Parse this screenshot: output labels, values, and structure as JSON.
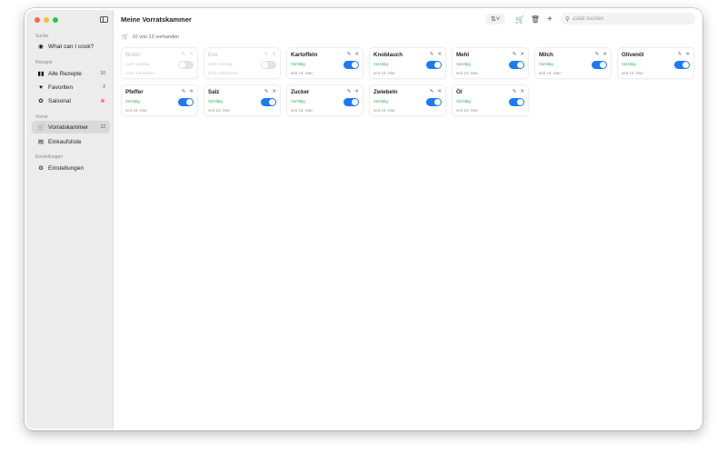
{
  "window": {
    "title": "Meine Vorratskammer"
  },
  "sidebar": {
    "sections": [
      {
        "header": "Suche"
      },
      {
        "header": "Rezepte"
      },
      {
        "header": "Vorrat"
      },
      {
        "header": "Einstellungen"
      }
    ],
    "items": [
      {
        "label": "What can I cook?",
        "icon": "chef-hat-icon"
      },
      {
        "label": "Alle Rezepte",
        "icon": "books-icon",
        "badge": "10"
      },
      {
        "label": "Favoriten",
        "icon": "heart-icon",
        "badge": "2"
      },
      {
        "label": "Saisonal",
        "icon": "leaf-icon",
        "badge_color": "#ff6fa0"
      },
      {
        "label": "Vorratskammer",
        "icon": "cart-icon",
        "badge": "12",
        "active": true
      },
      {
        "label": "Einkaufsliste",
        "icon": "clipboard-icon"
      },
      {
        "label": "Einstellungen",
        "icon": "gear-icon"
      }
    ]
  },
  "toolbar": {
    "search_placeholder": "Zutat suchen"
  },
  "summary": "10 von 12 vorhanden",
  "pantry": [
    {
      "name": "Butter",
      "status": "nicht vorrätig",
      "date": "nicht vorhanden",
      "available": false
    },
    {
      "name": "Eier",
      "status": "nicht vorrätig",
      "date": "nicht vorhanden",
      "available": false
    },
    {
      "name": "Kartoffeln",
      "status": "Vorrätig",
      "date": "seit 16. Mar",
      "available": true
    },
    {
      "name": "Knoblauch",
      "status": "Vorrätig",
      "date": "seit 16. Mar",
      "available": true
    },
    {
      "name": "Mehl",
      "status": "Vorrätig",
      "date": "seit 16. Mar",
      "available": true
    },
    {
      "name": "Milch",
      "status": "Vorrätig",
      "date": "seit 16. Mar",
      "available": true
    },
    {
      "name": "Olivenöl",
      "status": "Vorrätig",
      "date": "seit 16. Mar",
      "available": true
    },
    {
      "name": "Pfeffer",
      "status": "Vorrätig",
      "date": "seit 16. Mar",
      "available": true
    },
    {
      "name": "Salz",
      "status": "Vorrätig",
      "date": "seit 16. Mar",
      "available": true
    },
    {
      "name": "Zucker",
      "status": "Vorrätig",
      "date": "seit 16. Mar",
      "available": true
    },
    {
      "name": "Zwiebeln",
      "status": "Vorrätig",
      "date": "seit 16. Mar",
      "available": true
    },
    {
      "name": "Öl",
      "status": "Vorrätig",
      "date": "seit 16. Mar",
      "available": true
    }
  ],
  "colors": {
    "accent": "#1a7bf2",
    "status_ok": "#2fb34a"
  }
}
